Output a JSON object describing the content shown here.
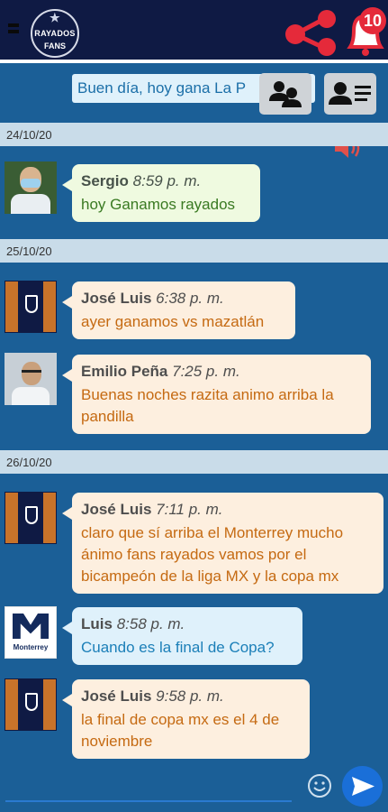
{
  "header": {
    "logo_line1": "RAYADOS",
    "logo_line2": "FANS",
    "notification_count": "10"
  },
  "compose_preview": "Buen día, hoy gana La P",
  "toolbar": {
    "users_icon": "group-icon",
    "profile_icon": "profile-list-icon",
    "sound_icon": "speaker-icon"
  },
  "chat": [
    {
      "date": "24/10/20",
      "messages": [
        {
          "name": "Sergio",
          "time": "8:59 p. m.",
          "text": "hoy Ganamos rayados",
          "avatar": "photo-masked-man",
          "style": "green"
        }
      ]
    },
    {
      "date": "25/10/20",
      "messages": [
        {
          "name": "José Luis",
          "time": "6:38 p. m.",
          "text": "ayer ganamos vs mazatlán",
          "avatar": "rayados-crest",
          "style": "orange"
        },
        {
          "name": "Emilio Peña",
          "time": "7:25 p. m.",
          "text": "Buenas noches razita animo arriba la pandilla",
          "avatar": "photo-man-glasses",
          "style": "orange"
        }
      ]
    },
    {
      "date": "26/10/20",
      "messages": [
        {
          "name": "José Luis",
          "time": "7:11 p. m.",
          "text": "claro que sí arriba el Monterrey mucho ánimo fans rayados vamos por el bicampeón de la liga MX y la copa mx",
          "avatar": "rayados-crest",
          "style": "orange"
        },
        {
          "name": "Luis",
          "time": "8:58 p. m.",
          "text": "Cuando es la final de Copa?",
          "avatar": "monterrey-logo",
          "style": "blue",
          "avatar_text": "Monterrey"
        },
        {
          "name": "José Luis",
          "time": "9:58 p. m.",
          "text": "la final de copa mx es el 4 de noviembre",
          "avatar": "rayados-crest",
          "style": "orange"
        }
      ]
    }
  ],
  "input": {
    "emoji_icon": "emoji-icon",
    "send_icon": "send-icon"
  },
  "colors": {
    "header": "#0f1a44",
    "background": "#1b5f97",
    "accent_red": "#e52a3a",
    "send_blue": "#1a6fd8"
  }
}
